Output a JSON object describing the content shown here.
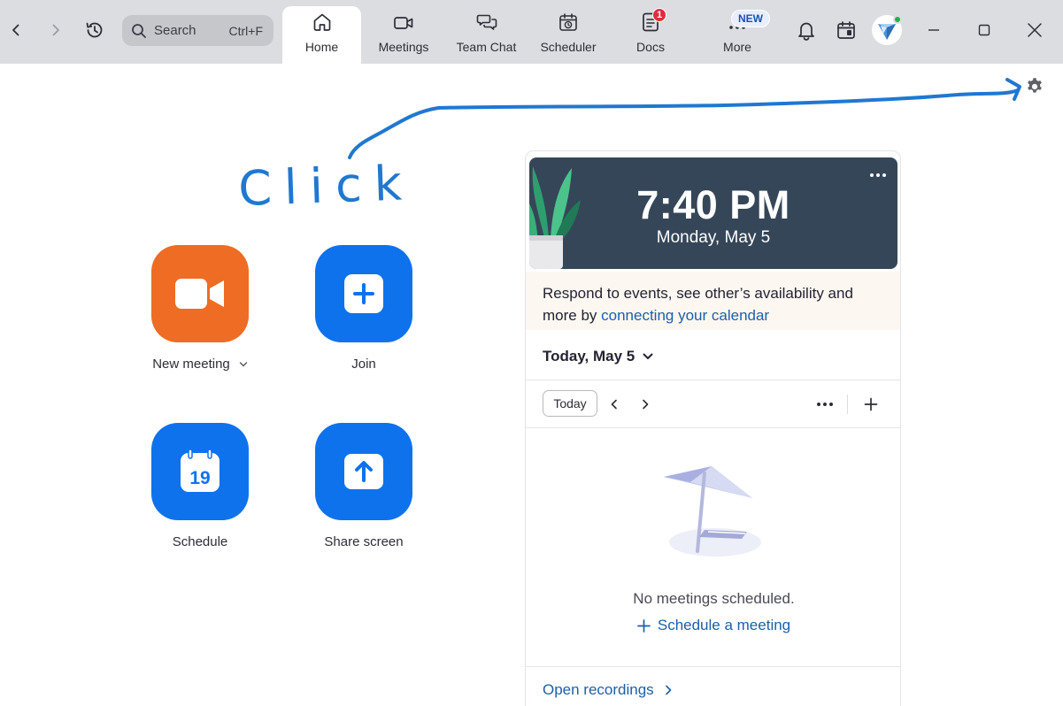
{
  "topbar": {
    "search": {
      "label": "Search",
      "shortcut": "Ctrl+F"
    },
    "tabs": [
      {
        "label": "Home",
        "icon": "home-icon",
        "active": true
      },
      {
        "label": "Meetings",
        "icon": "video-camera-icon"
      },
      {
        "label": "Team Chat",
        "icon": "chat-bubbles-icon"
      },
      {
        "label": "Scheduler",
        "icon": "calendar-clock-icon"
      },
      {
        "label": "Docs",
        "icon": "document-icon",
        "badge": "1"
      },
      {
        "label": "More",
        "icon": "more-dots-icon",
        "badge": "NEW"
      }
    ],
    "icons": [
      "back-arrow-icon",
      "forward-arrow-icon",
      "history-icon",
      "bell-icon",
      "calendar-panel-icon",
      "minimize-icon",
      "maximize-icon",
      "close-icon"
    ]
  },
  "annotation": {
    "text": "Click"
  },
  "actions": [
    {
      "label": "New meeting",
      "icon": "video-camera-icon"
    },
    {
      "label": "Join",
      "icon": "plus-icon"
    },
    {
      "label": "Schedule",
      "icon": "calendar-19-icon",
      "icon_text": "19"
    },
    {
      "label": "Share screen",
      "icon": "share-up-arrow-icon"
    }
  ],
  "calendar": {
    "time": "7:40 PM",
    "date": "Monday, May 5",
    "notice_text": "Respond to events, see other’s availability and more by ",
    "notice_link": "connecting your calendar",
    "day_selector": "Today, May 5",
    "today_button": "Today",
    "empty_text": "No meetings scheduled.",
    "schedule_link": "Schedule a meeting",
    "open_recordings": "Open recordings"
  },
  "colors": {
    "topbar": "#dcdde0",
    "orange_tile": "#ee6c23",
    "blue_tile": "#0e72ed",
    "hero_bg": "#354658",
    "link": "#1d5fa8",
    "annotation": "#1f78d1"
  }
}
